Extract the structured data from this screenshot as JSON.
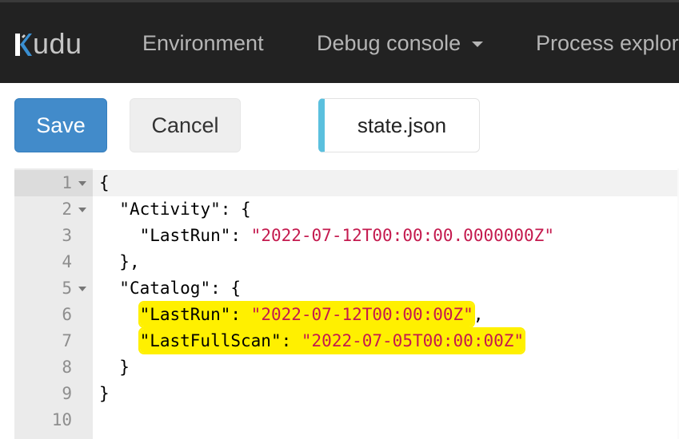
{
  "navbar": {
    "brand": {
      "k_icon": "kudu-k-logo-icon",
      "text": "udu"
    },
    "items": [
      {
        "label": "Environment"
      },
      {
        "label": "Debug console"
      },
      {
        "label": "Process explor"
      }
    ]
  },
  "toolbar": {
    "save_label": "Save",
    "cancel_label": "Cancel",
    "file_name": "state.json"
  },
  "colors": {
    "navbar_bg": "#222222",
    "primary_button": "#428bca",
    "file_tab_accent": "#5bc0de",
    "json_string": "#c41a4e",
    "highlight": "#fff000"
  },
  "editor": {
    "line_numbers": [
      "1",
      "2",
      "3",
      "4",
      "5",
      "6",
      "7",
      "8",
      "9",
      "10"
    ],
    "fold_icon": "fold-arrow-icon",
    "lines": {
      "l1_open": "{",
      "l2_key": "\"Activity\"",
      "l2_rest": ": {",
      "l3_key": "\"LastRun\"",
      "l3_sep": ": ",
      "l3_value": "\"2022-07-12T00:00:00.0000000Z\"",
      "l4_close": "},",
      "l5_key": "\"Catalog\"",
      "l5_rest": ": {",
      "l6_key": "\"LastRun\"",
      "l6_sep": ": ",
      "l6_value": "\"2022-07-12T00:00:00Z\"",
      "l6_comma": ",",
      "l7_key": "\"LastFullScan\"",
      "l7_sep": ": ",
      "l7_value": "\"2022-07-05T00:00:00Z\"",
      "l8_close": "}",
      "l9_close": "}"
    }
  }
}
